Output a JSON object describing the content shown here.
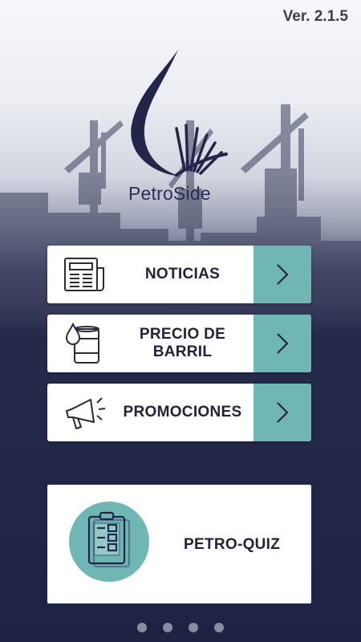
{
  "version": "Ver. 2.1.5",
  "brand": {
    "name": "PetroSide",
    "logo_icon": "petroside-logo-icon"
  },
  "menu": [
    {
      "id": "noticias",
      "label_1": "NOTICIAS",
      "label_2": "",
      "icon": "newspaper-icon"
    },
    {
      "id": "precio",
      "label_1": "PRECIO DE",
      "label_2": "BARRIL",
      "icon": "oil-barrel-icon"
    },
    {
      "id": "promociones",
      "label_1": "PROMOCIONES",
      "label_2": "",
      "icon": "megaphone-icon"
    }
  ],
  "quiz": {
    "label": "PETRO-QUIZ",
    "icon": "clipboard-icon"
  },
  "pager": {
    "count": 4
  },
  "colors": {
    "accent": "#6fb6b5",
    "navy": "#1f2343",
    "brand_text": "#2b2e52"
  }
}
